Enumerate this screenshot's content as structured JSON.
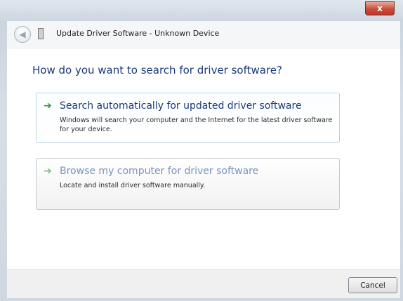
{
  "window": {
    "close_glyph": "x",
    "title": "Update Driver Software - Unknown Device"
  },
  "dialog": {
    "heading": "How do you want to search for driver software?",
    "options": [
      {
        "title": "Search automatically for updated driver software",
        "description": "Windows will search your computer and the Internet for the latest driver software for your device.",
        "icon": "green-arrow-icon"
      },
      {
        "title": "Browse my computer for driver software",
        "description": "Locate and install driver software manually.",
        "icon": "green-arrow-icon"
      }
    ]
  },
  "footer": {
    "cancel_label": "Cancel"
  },
  "colors": {
    "heading": "#1c3a78",
    "arrow": "#2e9a2e",
    "close_button": "#c94c3a"
  }
}
